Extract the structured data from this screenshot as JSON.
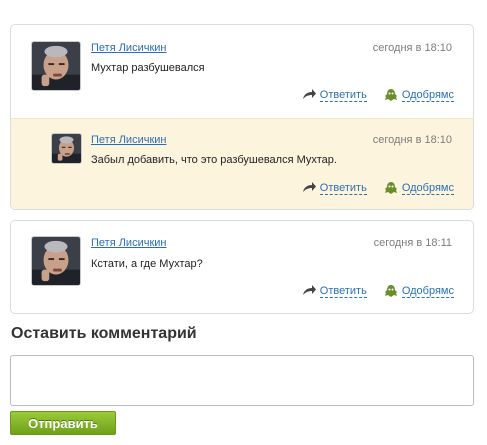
{
  "comments": [
    {
      "author": "Петя Лисичкин",
      "date": "сегодня в 18:10",
      "text": "Мухтар разбушевался",
      "reply_label": "Ответить",
      "approve_label": "Одобрямс"
    },
    {
      "author": "Петя Лисичкин",
      "date": "сегодня в 18:10",
      "text": "Забыл добавить, что это разбушевался Мухтар.",
      "reply_label": "Ответить",
      "approve_label": "Одобрямс"
    },
    {
      "author": "Петя Лисичкин",
      "date": "сегодня в 18:11",
      "text": "Кстати, а где Мухтар?",
      "reply_label": "Ответить",
      "approve_label": "Одобрямс"
    }
  ],
  "form": {
    "title": "Оставить комментарий",
    "textarea_value": "",
    "submit_label": "Отправить"
  },
  "icons": {
    "reply": "reply-arrow-icon",
    "approve": "approve-blob-icon"
  },
  "colors": {
    "link": "#2a6fb6",
    "reply_background": "#fdf4de",
    "submit_button": "#7fb224"
  }
}
